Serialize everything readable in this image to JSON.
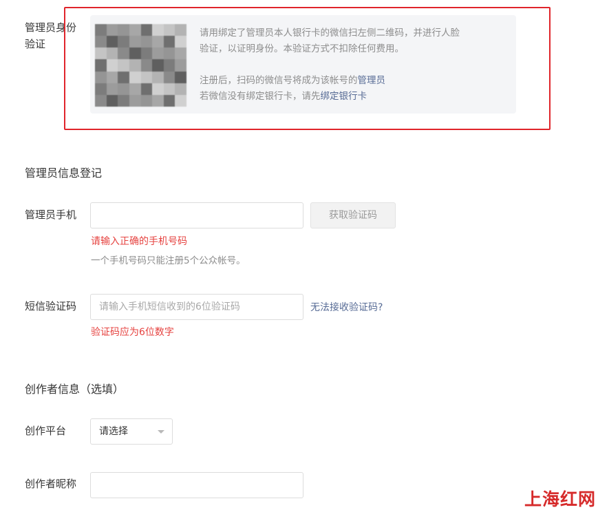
{
  "admin_verify": {
    "label": "管理员身份验证",
    "desc_line1": "请用绑定了管理员本人银行卡的微信扫左侧二维码，并进行人脸",
    "desc_line2": "验证，以证明身份。本验证方式不扣除任何费用。",
    "note_line1_prefix": "注册后，扫码的微信号将成为该帐号的",
    "note_line1_link": "管理员",
    "note_line2_prefix": "若微信没有绑定银行卡，请先",
    "note_line2_link": "绑定银行卡"
  },
  "admin_info": {
    "section_title": "管理员信息登记",
    "phone_label": "管理员手机",
    "phone_value": "",
    "get_code_button": "获取验证码",
    "phone_error": "请输入正确的手机号码",
    "phone_hint": "一个手机号码只能注册5个公众帐号。",
    "sms_label": "短信验证码",
    "sms_placeholder": "请输入手机短信收到的6位验证码",
    "sms_help_link": "无法接收验证码?",
    "sms_error": "验证码应为6位数字"
  },
  "creator_info": {
    "section_title": "创作者信息（选填）",
    "platform_label": "创作平台",
    "platform_selected": "请选择",
    "nickname_label": "创作者昵称",
    "nickname_value": ""
  },
  "watermark": {
    "text": "上海红网"
  },
  "colors": {
    "highlight_border": "#e0242a",
    "error": "#e64340",
    "link": "#576b95",
    "panel_bg": "#f4f5f7"
  }
}
